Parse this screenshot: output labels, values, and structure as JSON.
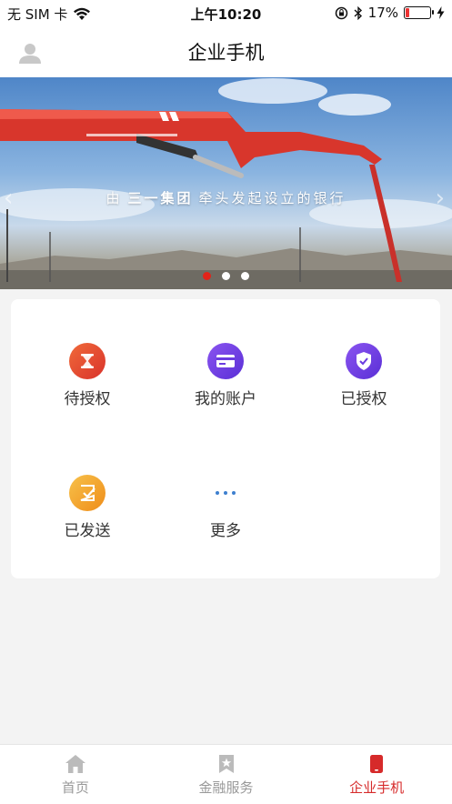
{
  "status_bar": {
    "carrier": "无 SIM 卡",
    "time": "上午10:20",
    "battery": "17%",
    "battery_level": 0.17
  },
  "header": {
    "title": "企业手机"
  },
  "banner": {
    "slogan_pre": "由",
    "slogan_brand": "三一集团",
    "slogan_post": "牵头发起设立的银行",
    "slide_count": 3,
    "active_slide": 1
  },
  "grid": {
    "items": [
      {
        "label": "待授权",
        "icon": "hourglass-icon",
        "color": "#e6402f"
      },
      {
        "label": "我的账户",
        "icon": "card-icon",
        "color": "#6a3be0"
      },
      {
        "label": "已授权",
        "icon": "shield-check-icon",
        "color": "#6a3be0"
      },
      {
        "label": "已发送",
        "icon": "sent-check-icon",
        "color": "#f0a020"
      },
      {
        "label": "更多",
        "icon": "more-icon",
        "color": "#3d7fcf"
      }
    ]
  },
  "tabbar": {
    "tabs": [
      {
        "label": "首页",
        "icon": "home-icon"
      },
      {
        "label": "金融服务",
        "icon": "bookmark-star-icon"
      },
      {
        "label": "企业手机",
        "icon": "phone-icon",
        "active": true
      }
    ]
  },
  "colors": {
    "accent": "#d62a2a",
    "inactive": "#999999"
  }
}
